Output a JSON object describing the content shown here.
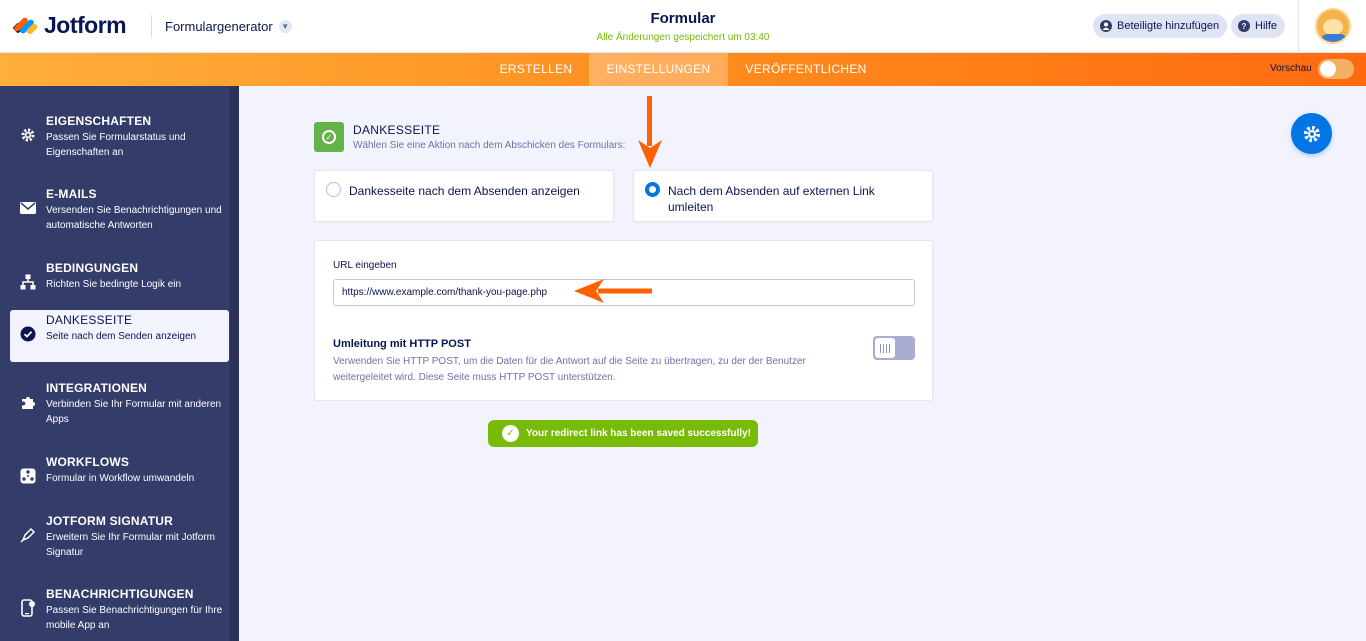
{
  "header": {
    "logo_text": "Jotform",
    "builder_label": "Formulargenerator",
    "form_title": "Formular",
    "save_status": "Alle Änderungen gespeichert um 03:40",
    "invite_button": "Beteiligte hinzufügen",
    "help_button": "Hilfe"
  },
  "tabs": [
    {
      "label": "ERSTELLEN"
    },
    {
      "label": "EINSTELLUNGEN"
    },
    {
      "label": "VERÖFFENTLICHEN"
    }
  ],
  "preview_label": "Vorschau",
  "sidebar": {
    "items": [
      {
        "title": "EIGENSCHAFTEN",
        "desc": "Passen Sie Formularstatus und Eigenschaften an",
        "icon": "gear-icon"
      },
      {
        "title": "E-MAILS",
        "desc": "Versenden Sie Benachrichtigungen und automatische Antworten",
        "icon": "envelope-icon"
      },
      {
        "title": "BEDINGUNGEN",
        "desc": "Richten Sie bedingte Logik ein",
        "icon": "sitemap-icon"
      },
      {
        "title": "DANKESSEITE",
        "desc": "Seite nach dem Senden anzeigen",
        "icon": "check-circle-icon"
      },
      {
        "title": "INTEGRATIONEN",
        "desc": "Verbinden Sie Ihr Formular mit anderen Apps",
        "icon": "puzzle-icon"
      },
      {
        "title": "WORKFLOWS",
        "desc": "Formular in Workflow umwandeln",
        "icon": "workflow-icon"
      },
      {
        "title": "JOTFORM SIGNATUR",
        "desc": "Erweitern Sie Ihr Formular mit Jotform Signatur",
        "icon": "pen-icon"
      },
      {
        "title": "BENACHRICHTIGUNGEN",
        "desc": "Passen Sie Benachrichtigungen für Ihre mobile App an",
        "icon": "mobile-bell-icon"
      }
    ]
  },
  "thankyou": {
    "title": "DANKESSEITE",
    "subtitle": "Wählen Sie eine Aktion nach dem Abschicken des Formulars:",
    "option_show_page": "Dankesseite nach dem Absenden anzeigen",
    "option_redirect": "Nach dem Absenden auf externen Link umleiten",
    "selected": "redirect"
  },
  "url_section": {
    "label": "URL eingeben",
    "value": "https://www.example.com/thank-you-page.php",
    "post_title": "Umleitung mit HTTP POST",
    "post_desc": "Verwenden Sie HTTP POST, um die Daten für die Antwort auf die Seite zu übertragen, zu der der Benutzer weitergeleitet wird. Diese Seite muss HTTP POST unterstützen.",
    "post_enabled": false
  },
  "toast": {
    "message": "Your redirect link has been saved successfully!"
  },
  "colors": {
    "accent_orange": "#ff6a10",
    "primary_blue": "#0075e3",
    "success_green": "#78bb07",
    "sidebar_bg": "#343c6a"
  }
}
